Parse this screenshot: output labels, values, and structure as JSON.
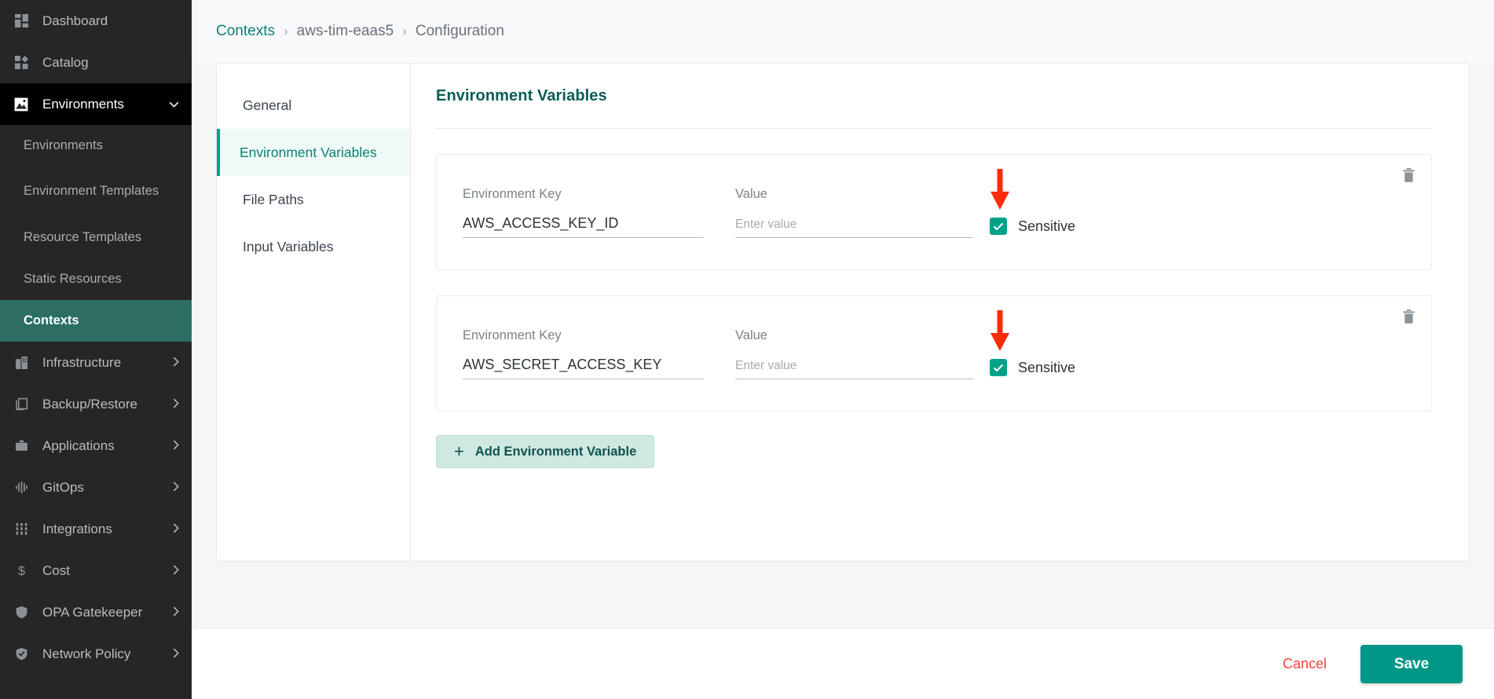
{
  "sidebar": {
    "items": [
      {
        "label": "Dashboard",
        "icon": "grid-dashboard-icon",
        "type": "top",
        "state": "normal",
        "chevron": ""
      },
      {
        "label": "Catalog",
        "icon": "catalog-icon",
        "type": "top",
        "state": "normal",
        "chevron": ""
      },
      {
        "label": "Environments",
        "icon": "environments-image-icon",
        "type": "top",
        "state": "expanded",
        "chevron": "chevron-down-icon"
      },
      {
        "label": "Environments",
        "icon": "",
        "type": "sub",
        "state": "normal",
        "chevron": ""
      },
      {
        "label": "Environment Templates",
        "icon": "",
        "type": "sub",
        "state": "normal",
        "chevron": ""
      },
      {
        "label": "Resource Templates",
        "icon": "",
        "type": "sub",
        "state": "normal",
        "chevron": ""
      },
      {
        "label": "Static Resources",
        "icon": "",
        "type": "sub",
        "state": "normal",
        "chevron": ""
      },
      {
        "label": "Contexts",
        "icon": "",
        "type": "sub",
        "state": "active",
        "chevron": ""
      },
      {
        "label": "Infrastructure",
        "icon": "building-icon",
        "type": "top",
        "state": "normal",
        "chevron": "chevron-right-icon"
      },
      {
        "label": "Backup/Restore",
        "icon": "copy-icon",
        "type": "top",
        "state": "normal",
        "chevron": "chevron-right-icon"
      },
      {
        "label": "Applications",
        "icon": "briefcase-icon",
        "type": "top",
        "state": "normal",
        "chevron": "chevron-right-icon"
      },
      {
        "label": "GitOps",
        "icon": "gitops-icon",
        "type": "top",
        "state": "normal",
        "chevron": "chevron-right-icon"
      },
      {
        "label": "Integrations",
        "icon": "integrations-icon",
        "type": "top",
        "state": "normal",
        "chevron": "chevron-right-icon"
      },
      {
        "label": "Cost",
        "icon": "dollar-icon",
        "type": "top",
        "state": "normal",
        "chevron": "chevron-right-icon"
      },
      {
        "label": "OPA Gatekeeper",
        "icon": "shield-icon",
        "type": "top",
        "state": "normal",
        "chevron": "chevron-right-icon"
      },
      {
        "label": "Network Policy",
        "icon": "shield-check-icon",
        "type": "top",
        "state": "normal",
        "chevron": "chevron-right-icon"
      }
    ]
  },
  "breadcrumb": {
    "root": "Contexts",
    "context": "aws-tim-eaas5",
    "page": "Configuration",
    "separator": "›"
  },
  "tabs": [
    {
      "label": "General",
      "active": false
    },
    {
      "label": "Environment Variables",
      "active": true
    },
    {
      "label": "File Paths",
      "active": false
    },
    {
      "label": "Input Variables",
      "active": false
    }
  ],
  "panel": {
    "title": "Environment Variables",
    "key_label": "Environment Key",
    "value_label": "Value",
    "value_placeholder": "Enter value",
    "sensitive_label": "Sensitive",
    "delete_icon": "trash-icon",
    "add_button": "Add Environment Variable",
    "add_icon": "plus-icon"
  },
  "variables": [
    {
      "key": "AWS_ACCESS_KEY_ID",
      "value": "",
      "sensitive": true
    },
    {
      "key": "AWS_SECRET_ACCESS_KEY",
      "value": "",
      "sensitive": true
    }
  ],
  "annotations": [
    {
      "type": "red-down-arrow",
      "target": "sensitive-checkbox-0"
    },
    {
      "type": "red-down-arrow",
      "target": "sensitive-checkbox-1"
    }
  ],
  "footer": {
    "cancel_label": "Cancel",
    "save_label": "Save"
  },
  "colors": {
    "accent_teal": "#009688",
    "accent_dark_teal": "#0f8072",
    "sidebar_bg": "#262626",
    "sidebar_active": "#2c6e63",
    "cancel_red": "#f4433a",
    "annotation_red": "#fc2b08",
    "checkbox_teal": "#00a189"
  }
}
